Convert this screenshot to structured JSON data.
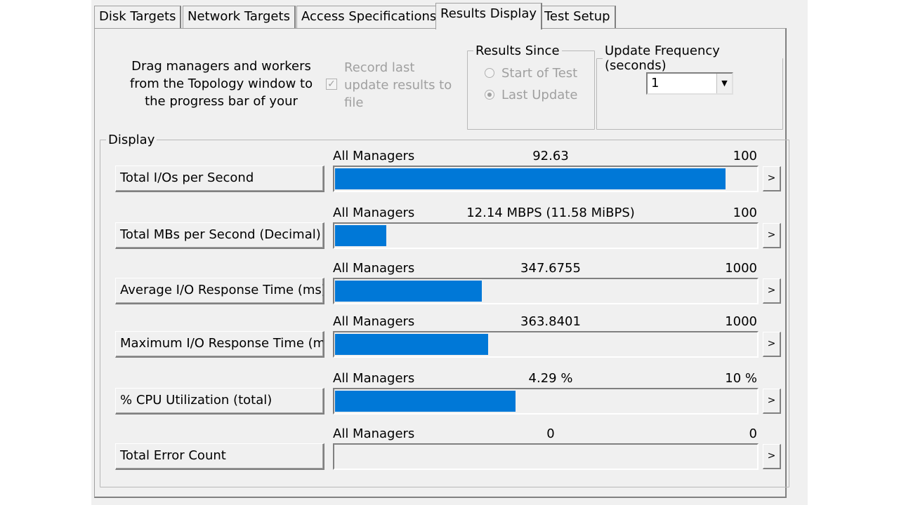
{
  "tabs": [
    {
      "label": "Disk Targets"
    },
    {
      "label": "Network Targets"
    },
    {
      "label": "Access Specifications"
    },
    {
      "label": "Results Display"
    },
    {
      "label": "Test Setup"
    }
  ],
  "note_text": "Drag managers and workers from the Topology window to the progress bar of your",
  "record": {
    "label": "Record last update results to file",
    "checked": true
  },
  "results_since": {
    "legend": "Results Since",
    "options": [
      {
        "label": "Start of Test",
        "selected": false
      },
      {
        "label": "Last Update",
        "selected": true
      }
    ]
  },
  "update_frequency": {
    "legend": "Update Frequency (seconds)",
    "value": "1"
  },
  "display": {
    "legend": "Display",
    "button_glyph": ">",
    "metrics": [
      {
        "label": "Total I/Os per Second",
        "source": "All Managers",
        "value": "92.63",
        "max": "100",
        "fraction": 0.9263
      },
      {
        "label": "Total MBs per Second (Decimal)",
        "source": "All Managers",
        "value": "12.14 MBPS (11.58 MiBPS)",
        "max": "100",
        "fraction": 0.1214
      },
      {
        "label": "Average I/O Response Time (ms)",
        "source": "All Managers",
        "value": "347.6755",
        "max": "1000",
        "fraction": 0.3477
      },
      {
        "label": "Maximum I/O Response Time (ms)",
        "source": "All Managers",
        "value": "363.8401",
        "max": "1000",
        "fraction": 0.3638
      },
      {
        "label": "% CPU Utilization (total)",
        "source": "All Managers",
        "value": "4.29 %",
        "max": "10 %",
        "fraction": 0.429
      },
      {
        "label": "Total Error Count",
        "source": "All Managers",
        "value": "0",
        "max": "0",
        "fraction": 0
      }
    ]
  },
  "colors": {
    "bar_fill": "#0078d7",
    "window_bg": "#f0f0f0"
  }
}
